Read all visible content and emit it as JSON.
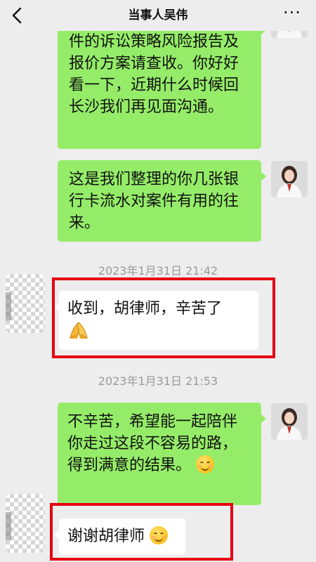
{
  "header": {
    "title": "当事人吴伟",
    "back_icon": "chevron-left-icon",
    "more_label": "···"
  },
  "messages": [
    {
      "sender": "lawyer",
      "text": "件的诉讼策略风险报告及报价方案请查收。你好好看一下，近期什么时候回长沙我们再见面沟通。"
    },
    {
      "sender": "lawyer",
      "text": "这是我们整理的你几张银行卡流水对案件有用的往来。"
    },
    {
      "sender": "timestamp",
      "text": "2023年1月31日 21:42"
    },
    {
      "sender": "client",
      "text": "收到，胡律师，辛苦了",
      "emoji": "folded-hands-icon"
    },
    {
      "sender": "timestamp",
      "text": "2023年1月31日 21:53"
    },
    {
      "sender": "lawyer",
      "text": "不辛苦，希望能一起陪伴你走过这段不容易的路，得到满意的结果。",
      "emoji": "smile-icon"
    },
    {
      "sender": "client",
      "text": "谢谢胡律师",
      "emoji": "smile-icon"
    }
  ],
  "colors": {
    "background": "#ededed",
    "sent_bubble": "#95ec69",
    "received_bubble": "#ffffff",
    "highlight_border": "#e60012",
    "timestamp_text": "#9a9a9a"
  }
}
